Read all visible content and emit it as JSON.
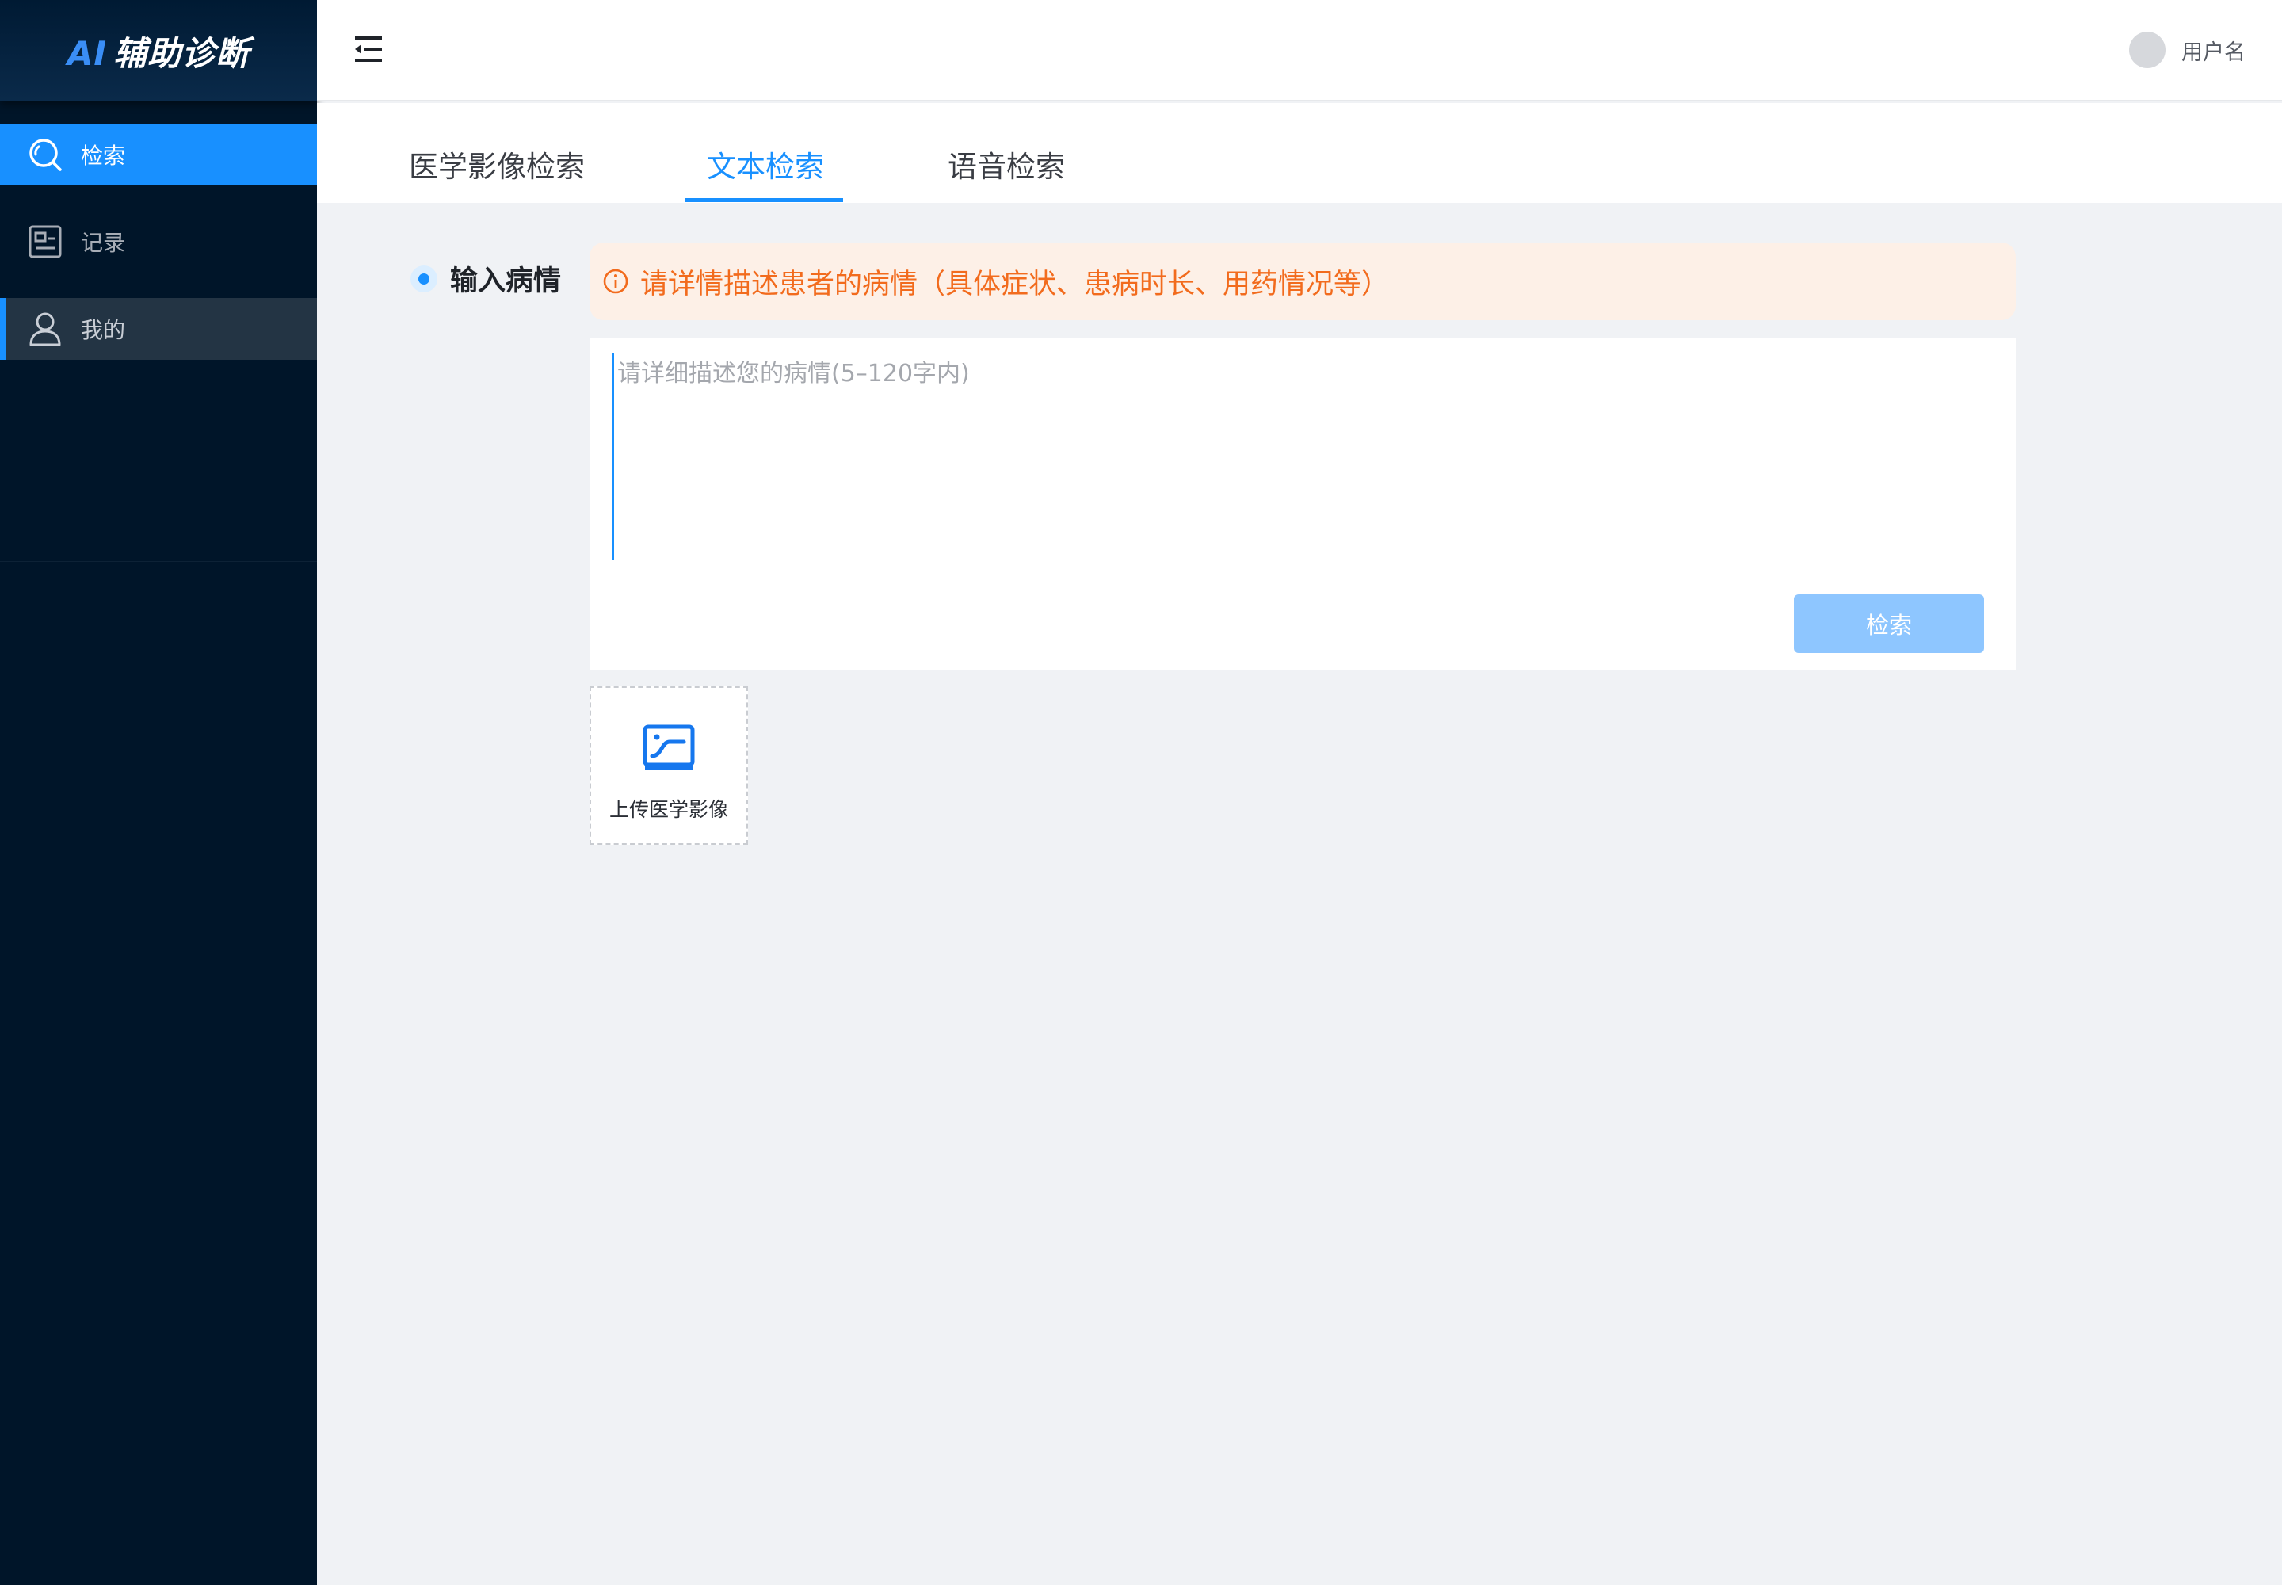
{
  "app": {
    "logo_ai": "AI",
    "logo_rest": "辅助诊断"
  },
  "sidebar": {
    "items": [
      {
        "label": "检索",
        "icon": "search-icon",
        "state": "active"
      },
      {
        "label": "记录",
        "icon": "record-icon",
        "state": "normal"
      },
      {
        "label": "我的",
        "icon": "user-icon",
        "state": "hover"
      }
    ]
  },
  "header": {
    "username": "用户名"
  },
  "tabs": [
    {
      "label": "医学影像检索",
      "active": false
    },
    {
      "label": "文本检索",
      "active": true
    },
    {
      "label": "语音检索",
      "active": false
    }
  ],
  "form": {
    "section_title": "输入病情",
    "tip": "请详情描述患者的病情（具体症状、患病时长、用药情况等）",
    "placeholder": "请详细描述您的病情(5–120字内)",
    "value": "",
    "search_button": "检索",
    "upload_label": "上传医学影像"
  },
  "colors": {
    "accent": "#1890ff",
    "sidebar_bg": "#001529",
    "warning_text": "#f26b1d",
    "warning_bg": "#fdf0e7",
    "disabled_button": "#8ec6ff"
  }
}
